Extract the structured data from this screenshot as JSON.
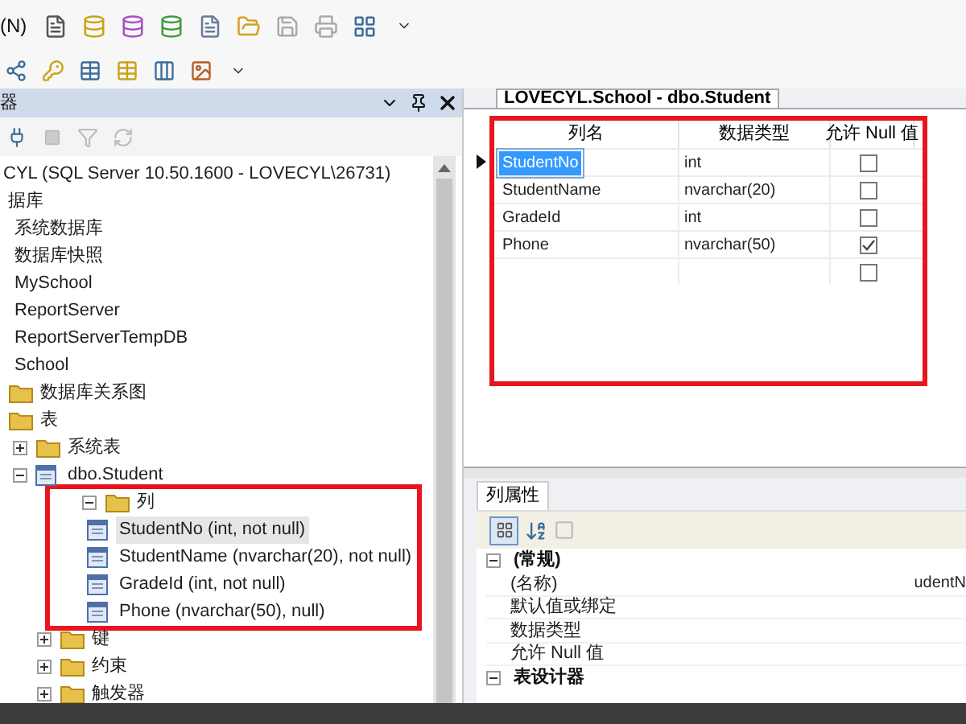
{
  "menu_fragment": "(N)",
  "explorer": {
    "title": "器",
    "tree": [
      {
        "label": "CYL (SQL Server 10.50.1600 - LOVECYL\\26731)"
      },
      {
        "label": "据库",
        "children": [
          {
            "label": "系统数据库"
          },
          {
            "label": "数据库快照"
          },
          {
            "label": "MySchool"
          },
          {
            "label": "ReportServer"
          },
          {
            "label": "ReportServerTempDB"
          },
          {
            "label": "School",
            "children": [
              {
                "label": "数据库关系图",
                "kind": "folder"
              },
              {
                "label": "表",
                "kind": "folder",
                "children": [
                  {
                    "label": "系统表",
                    "kind": "folder",
                    "expanded": false
                  },
                  {
                    "label": "dbo.Student",
                    "kind": "table",
                    "expanded": true,
                    "children": [
                      {
                        "label": "列",
                        "kind": "folder",
                        "expanded": true,
                        "highlighted": true,
                        "children": [
                          {
                            "label": "StudentNo (int, not null)",
                            "kind": "column",
                            "selected": true
                          },
                          {
                            "label": "StudentName (nvarchar(20), not null)",
                            "kind": "column",
                            "selected": false
                          },
                          {
                            "label": "GradeId (int, not null)",
                            "kind": "column",
                            "selected": false
                          },
                          {
                            "label": "Phone (nvarchar(50), null)",
                            "kind": "column",
                            "selected": false
                          }
                        ]
                      },
                      {
                        "label": "键",
                        "kind": "folder",
                        "expanded": false
                      },
                      {
                        "label": "约束",
                        "kind": "folder",
                        "expanded": false
                      },
                      {
                        "label": "触发器",
                        "kind": "folder",
                        "expanded": false
                      }
                    ]
                  }
                ]
              }
            ]
          }
        ]
      }
    ]
  },
  "designer": {
    "tab": "LOVECYL.School - dbo.Student",
    "highlighted": true,
    "columns": [
      "列名",
      "数据类型",
      "允许 Null 值"
    ],
    "rows": [
      {
        "name": "StudentNo",
        "type": "int",
        "allow_null": false,
        "selected": true
      },
      {
        "name": "StudentName",
        "type": "nvarchar(20)",
        "allow_null": false,
        "selected": false
      },
      {
        "name": "GradeId",
        "type": "int",
        "allow_null": false,
        "selected": false
      },
      {
        "name": "Phone",
        "type": "nvarchar(50)",
        "allow_null": true,
        "selected": false
      },
      {
        "allow_null": false,
        "selected": false
      }
    ]
  },
  "properties": {
    "tab": "列属性",
    "categories": [
      {
        "name": "(常规)",
        "expanded": true,
        "rows": [
          {
            "name": "(名称)",
            "value": "udentN"
          },
          {
            "name": "默认值或绑定"
          },
          {
            "name": "数据类型"
          },
          {
            "name": "允许 Null 值"
          }
        ]
      },
      {
        "name": "表设计器",
        "expanded": true
      }
    ]
  }
}
